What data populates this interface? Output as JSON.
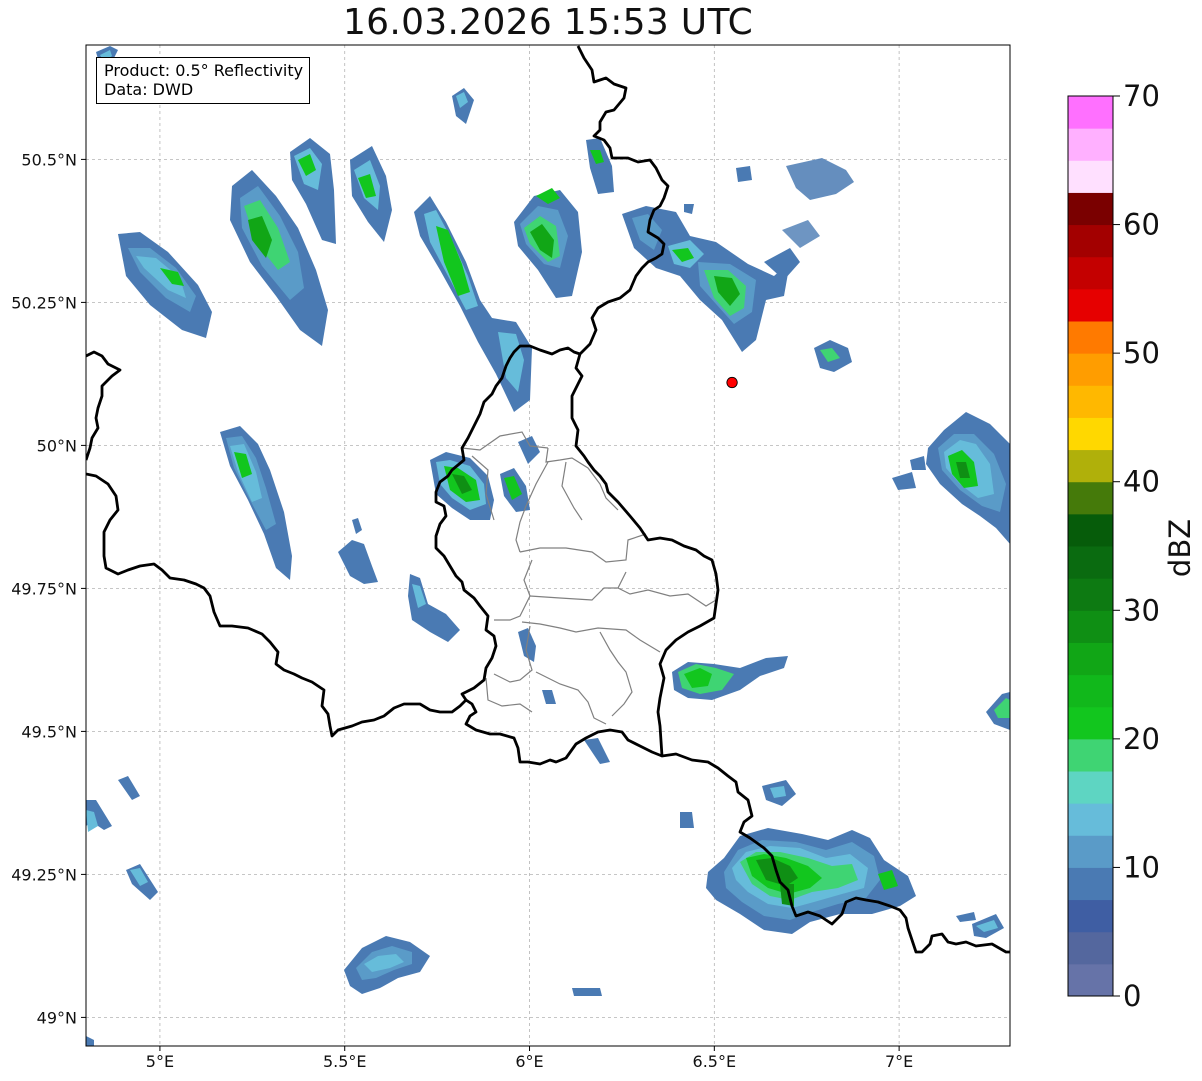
{
  "title": "16.03.2026 15:53 UTC",
  "info_box": {
    "product_line": "Product: 0.5° Reflectivity",
    "data_line": "Data: DWD"
  },
  "map": {
    "lon_range": [
      4.8,
      7.3
    ],
    "lat_range": [
      48.95,
      50.7
    ],
    "lon_ticks": [
      {
        "value": 5.0,
        "label": "5°E"
      },
      {
        "value": 5.5,
        "label": "5.5°E"
      },
      {
        "value": 6.0,
        "label": "6°E"
      },
      {
        "value": 6.5,
        "label": "6.5°E"
      },
      {
        "value": 7.0,
        "label": "7°E"
      }
    ],
    "lat_ticks": [
      {
        "value": 49.0,
        "label": "49°N"
      },
      {
        "value": 49.25,
        "label": "49.25°N"
      },
      {
        "value": 49.5,
        "label": "49.5°N"
      },
      {
        "value": 49.75,
        "label": "49.75°N"
      },
      {
        "value": 50.0,
        "label": "50°N"
      },
      {
        "value": 50.25,
        "label": "50.25°N"
      },
      {
        "value": 50.5,
        "label": "50.5°N"
      }
    ],
    "gridlines": true,
    "radar_site": {
      "lon": 6.548,
      "lat": 50.11,
      "color": "#ff0000"
    }
  },
  "colorbar": {
    "label": "dBZ",
    "min": 0,
    "max": 70,
    "step": 2.5,
    "tick_labels": [
      "0",
      "10",
      "20",
      "30",
      "40",
      "50",
      "60",
      "70"
    ],
    "colors": [
      "#6673a8",
      "#54679e",
      "#3f5ea3",
      "#4a7ab3",
      "#5a9bc8",
      "#66bcda",
      "#5ed5c2",
      "#3fd473",
      "#12c61e",
      "#11b81b",
      "#11a616",
      "#0f8f14",
      "#0d7a12",
      "#0a6b10",
      "#065c0a",
      "#457a0a",
      "#b0b00a",
      "#ffd800",
      "#ffb800",
      "#ff9d00",
      "#ff7a00",
      "#e60000",
      "#c40000",
      "#a30000",
      "#7a0000",
      "#ffe0ff",
      "#ffb0ff",
      "#ff70ff",
      "#ee38ee"
    ]
  }
}
